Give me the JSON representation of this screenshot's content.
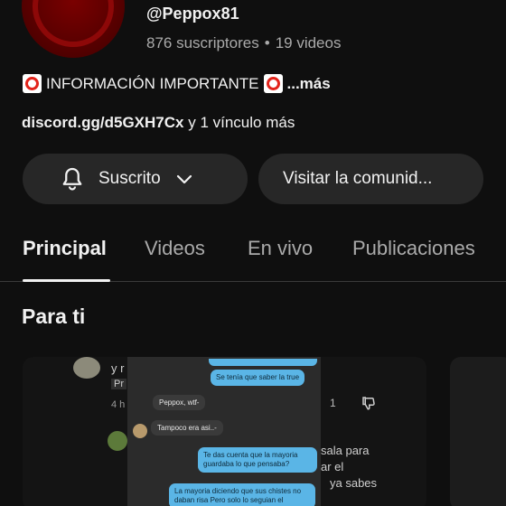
{
  "channel": {
    "handle": "@Peppox81",
    "subscribers": "876 suscriptores",
    "separator": "•",
    "videos": "19 videos",
    "description": "INFORMACIÓN IMPORTANTE",
    "more": "...más",
    "link": "discord.gg/d5GXH7Cx",
    "links_more": "y 1 vínculo más"
  },
  "buttons": {
    "subscribed": "Suscrito",
    "community": "Visitar la comunid..."
  },
  "tabs": [
    "Principal",
    "Videos",
    "En vivo",
    "Publicaciones"
  ],
  "section": {
    "title": "Para ti"
  },
  "thumbnail": {
    "chat_messages": [
      "Se tenía que saber la true",
      "Peppox, wtf-",
      "Tampoco era asi..-",
      "Te das cuenta que la mayoria guardaba lo que pensaba?",
      "La mayoria diciendo que sus chistes no daban risa Pero solo lo seguian el"
    ],
    "left_texts": [
      "y r",
      "Pr",
      "4 h"
    ],
    "right_texts": [
      "sala para",
      "ar el",
      "ya sabes",
      "1"
    ]
  },
  "colors": {
    "background": "#0f0f0f",
    "button_bg": "#272727",
    "avatar_red": "#8d0808",
    "chat_bubble": "#5ab5e6"
  },
  "icons": {
    "bell": "bell-icon",
    "chevron": "chevron-down-icon",
    "emoji": "red-circle-emoji",
    "dislike": "dislike-icon"
  }
}
